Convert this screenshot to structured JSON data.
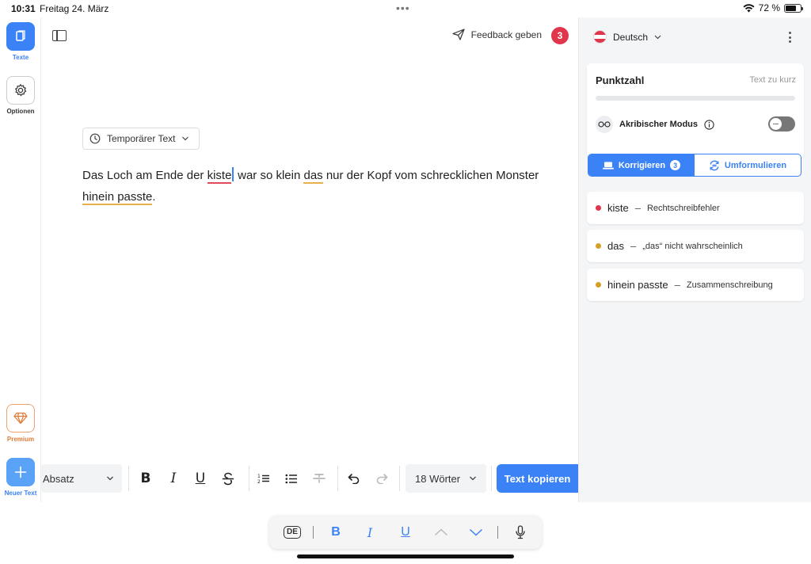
{
  "status_bar": {
    "time": "10:31",
    "date": "Freitag 24. März",
    "battery": "72 %",
    "battery_level": 0.72,
    "dots": "•••"
  },
  "left_nav": {
    "texte_label": "Texte",
    "options_label": "Optionen",
    "premium_label": "Premium",
    "new_text_label": "Neuer Text"
  },
  "editor": {
    "feedback_label": "Feedback geben",
    "issue_badge": "3",
    "temp_text_label": "Temporärer Text",
    "text": {
      "part1": "Das Loch am Ende der ",
      "err1": "kiste",
      "part2": " war so klein ",
      "err2": "das",
      "part3": " nur der Kopf vom schrecklichen Monster ",
      "err3": "hinein passte",
      "part4": "."
    }
  },
  "toolbar": {
    "paragraph_select": "Absatz",
    "words_select": "18 Wörter",
    "copy_button": "Text kopieren"
  },
  "right_panel": {
    "language": "Deutsch",
    "score": {
      "title": "Punktzahl",
      "hint": "Text zu kurz",
      "progress": 0
    },
    "akribisch_label": "Akribischer Modus",
    "akribisch_on": false,
    "tabs": {
      "correct_label": "Korrigieren",
      "correct_count": "3",
      "rephrase_label": "Umformulieren"
    },
    "issues": [
      {
        "word": "kiste",
        "sep": "–",
        "desc": "Rechtschreibfehler",
        "color": "#e0354b"
      },
      {
        "word": "das",
        "sep": "–",
        "desc": "„das“ nicht wahrscheinlich",
        "color": "#d4a02a"
      },
      {
        "word": "hinein passte",
        "sep": "–",
        "desc": "Zusammenschreibung",
        "color": "#d4a02a"
      }
    ]
  },
  "keyboard_bar": {
    "lang_key": "DE",
    "bold": "B",
    "italic": "I",
    "underline": "U"
  },
  "colors": {
    "accent": "#3b82f6",
    "error_red": "#e0354b",
    "warning_yellow": "#d4a02a",
    "premium_orange": "#e07a35"
  }
}
